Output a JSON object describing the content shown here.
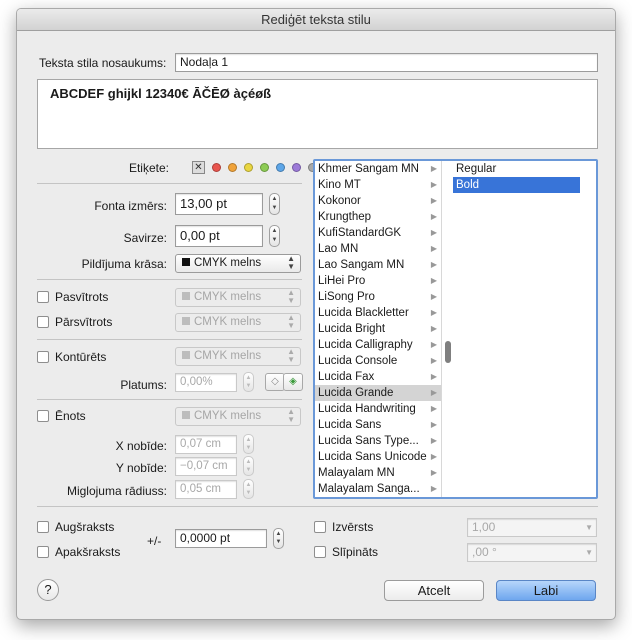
{
  "window": {
    "title": "Rediģēt teksta stilu"
  },
  "style_name": {
    "label": "Teksta stila nosaukums:",
    "value": "Nodaļa 1"
  },
  "preview": {
    "text": "ABCDEF ghijkl 12340€ ĀČĒØ àçéøß"
  },
  "tag": {
    "label": "Etiķete:",
    "clear_symbol": "✕",
    "colors": [
      "#e8554e",
      "#f0a33a",
      "#e9d641",
      "#8dcc55",
      "#5da6e8",
      "#9c7ad8",
      "#a9a9a9"
    ]
  },
  "font_size": {
    "label": "Fonta izmērs:",
    "value": "13,00 pt"
  },
  "tracking": {
    "label": "Savirze:",
    "value": "0,00 pt"
  },
  "fill_color": {
    "label": "Pildījuma krāsa:",
    "value": "CMYK melns"
  },
  "underline": {
    "label": "Pasvītrots",
    "color": "CMYK melns"
  },
  "strikethrough": {
    "label": "Pārsvītrots",
    "color": "CMYK melns"
  },
  "outline": {
    "label": "Kontūrēts",
    "color": "CMYK melns",
    "width_label": "Platums:",
    "width_value": "0,00%"
  },
  "shadow": {
    "label": "Ēnots",
    "color": "CMYK melns",
    "x_label": "X nobīde:",
    "x_value": "0,07 cm",
    "y_label": "Y nobīde:",
    "y_value": "−0,07 cm",
    "blur_label": "Miglojuma rādiuss:",
    "blur_value": "0,05 cm"
  },
  "font_families": [
    "Khmer Sangam MN",
    "Kino MT",
    "Kokonor",
    "Krungthep",
    "KufiStandardGK",
    "Lao MN",
    "Lao Sangam MN",
    "LiHei Pro",
    "LiSong Pro",
    "Lucida Blackletter",
    "Lucida Bright",
    "Lucida Calligraphy",
    "Lucida Console",
    "Lucida Fax",
    "Lucida Grande",
    "Lucida Handwriting",
    "Lucida Sans",
    "Lucida Sans Type...",
    "Lucida Sans Unicode",
    "Malayalam MN",
    "Malayalam Sanga..."
  ],
  "selected_family": "Lucida Grande",
  "font_styles": [
    "Regular",
    "Bold"
  ],
  "selected_style": "Bold",
  "superscript": {
    "label": "Augšraksts"
  },
  "subscript": {
    "label": "Apakšraksts"
  },
  "baseline": {
    "label": "+/-",
    "value": "0,0000 pt"
  },
  "extended": {
    "label": "Izvērsts",
    "value": "1,00"
  },
  "italic": {
    "label": "Slīpināts",
    "value": ",00 °"
  },
  "buttons": {
    "help": "?",
    "cancel": "Atcelt",
    "ok": "Labi"
  }
}
